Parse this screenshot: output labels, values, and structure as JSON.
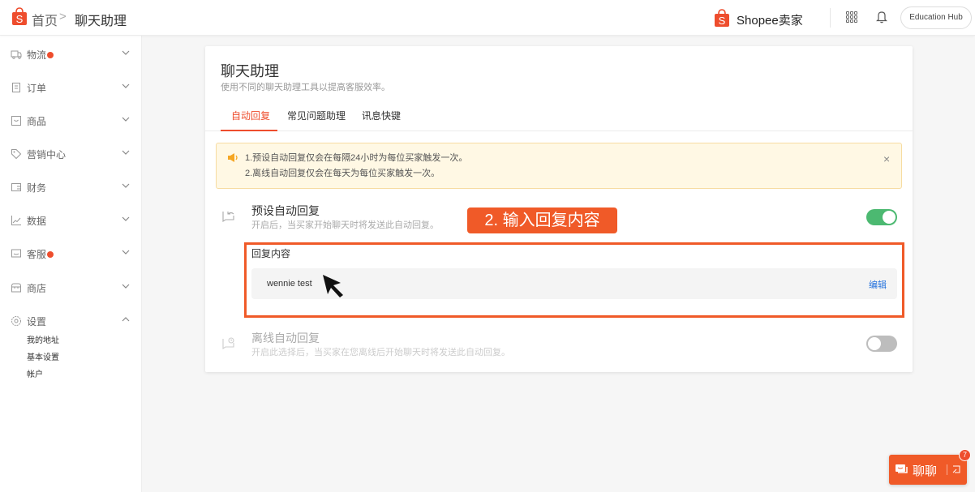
{
  "header": {
    "breadcrumb": {
      "home": "首页",
      "separator": ">",
      "current": "聊天助理"
    },
    "brand": "Shopee卖家",
    "education_hub": "Education Hub",
    "icons": [
      "apps-grid-icon",
      "bell-icon"
    ]
  },
  "sidebar": {
    "items": [
      {
        "label": "物流",
        "icon": "truck-icon",
        "dot": true,
        "expanded": false
      },
      {
        "label": "订单",
        "icon": "clipboard-icon",
        "dot": false,
        "expanded": false
      },
      {
        "label": "商品",
        "icon": "box-icon",
        "dot": false,
        "expanded": false
      },
      {
        "label": "营销中心",
        "icon": "tag-icon",
        "dot": false,
        "expanded": false
      },
      {
        "label": "财务",
        "icon": "wallet-icon",
        "dot": false,
        "expanded": false
      },
      {
        "label": "数据",
        "icon": "chart-icon",
        "dot": false,
        "expanded": false
      },
      {
        "label": "客服",
        "icon": "chat-icon",
        "dot": true,
        "expanded": false
      },
      {
        "label": "商店",
        "icon": "store-icon",
        "dot": false,
        "expanded": false
      },
      {
        "label": "设置",
        "icon": "gear-icon",
        "dot": false,
        "expanded": true
      }
    ],
    "settings_subitems": [
      "我的地址",
      "基本设置",
      "帐户"
    ]
  },
  "main": {
    "title": "聊天助理",
    "subtitle": "使用不同的聊天助理工具以提高客服效率。",
    "tabs": [
      {
        "label": "自动回复",
        "active": true
      },
      {
        "label": "常见问题助理",
        "active": false
      },
      {
        "label": "讯息快键",
        "active": false
      }
    ],
    "notice": {
      "lines": [
        "1.预设自动回复仅会在每隔24小时为每位买家触发一次。",
        "2.离线自动回复仅会在每天为每位买家触发一次。"
      ],
      "close": "×"
    },
    "default_reply": {
      "title": "预设自动回复",
      "description": "开启后，当买家开始聊天时将发送此自动回复。",
      "enabled": true,
      "content_label": "回复内容",
      "content_value": "wennie test",
      "edit_label": "编辑"
    },
    "offline_reply": {
      "title": "离线自动回复",
      "description": "开启此选择后，当买家在您离线后开始聊天时将发送此自动回复。",
      "enabled": false
    }
  },
  "annotation": {
    "label": "2. 输入回复内容",
    "color": "#f05a28"
  },
  "chat_widget": {
    "label": "聊聊",
    "badge_count": "7"
  },
  "colors": {
    "brand": "#ee4d2d",
    "toggle_on": "#4cb971",
    "toggle_off": "#bdbdbd",
    "link": "#2673dd",
    "notice_bg": "#fff8e4"
  }
}
